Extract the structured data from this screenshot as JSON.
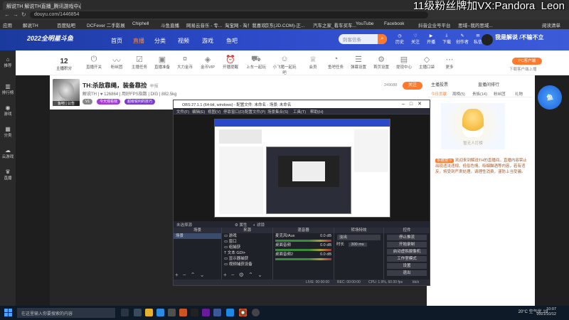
{
  "browser": {
    "tab_title": "解说TH 解说TH直播_腾讯游戏中心",
    "url": "douyu.com/1446854",
    "overlay_text": "11级粉丝牌加VX:Pandora_Leon",
    "bookmarks": [
      "应用",
      "解说TH",
      "百度贴吧",
      "DCFever 二手影展",
      "Chiphell",
      "斗鱼直播",
      "网易云音乐 - 专...",
      "淘宝网 - 淘！我喜欢",
      "京东(JD.COM)-正...",
      "汽车之家_看车买车...",
      "YouTube",
      "Facebook",
      "抖音企业号平台",
      "思域--我的思域..."
    ],
    "reading_list": "阅读清单"
  },
  "site": {
    "logo": "2022全明星斗鱼",
    "nav": [
      {
        "label": "首页"
      },
      {
        "label": "直播"
      },
      {
        "label": "分类"
      },
      {
        "label": "视频"
      },
      {
        "label": "游戏"
      },
      {
        "label": "鱼吧"
      }
    ],
    "search_placeholder": "刺客信条",
    "header_icons": [
      "历史",
      "关注",
      "开播",
      "下载",
      "创作者",
      "领鱼丸",
      "私信"
    ],
    "user_name": "我是解说 /不输不立"
  },
  "leftbar": [
    "推荐",
    "排行榜",
    "游戏",
    "分类",
    "云游戏",
    "直播"
  ],
  "category_bar": {
    "fav_count": "12",
    "fav_label": "主播积分",
    "items": [
      "直播开关",
      "粉丝团",
      "主播任务",
      "直播准备",
      "大力金币",
      "金币VIP",
      "开播提醒",
      "上车一起玩",
      "小飞猪一起玩吧",
      "会员",
      "鱼吧任务",
      "弹幕设置",
      "首页设置",
      "提现中心",
      "主播口袋",
      "更多"
    ],
    "pc_button": "PC客户端",
    "pc_sub": "下载客户端上播"
  },
  "room": {
    "title": "TH:杀敌靠绳，装备靠捡",
    "tag": "举报",
    "meta": "解说TH  |  ♥ 126864  |  用好FPS指数  |  DIG  |  882.5kg",
    "tags": [
      "V1",
      "今天观看我",
      "超级锐利的技巧"
    ],
    "fans": "249088",
    "follow": "关注",
    "avatar_caption": "鱼吧 | 公告"
  },
  "right_panel": {
    "tabs": [
      "主播投票",
      "直播间排行"
    ],
    "subtabs": [
      "今日贡献",
      "周榜(5)",
      "贵族(14)",
      "粉丝团",
      "礼物"
    ],
    "ill_caption": "暂无人打榜",
    "notice_label": "系统提示",
    "notice": "欢迎来到解说TH的直播间。直播内容禁止出现违法违规、低俗色情、吸烟酗酒等内容，若有违反，将受到严肃处理。请理性消费，谨防上当受骗。"
  },
  "obs": {
    "title": "OBS 27.1.1 (64-bit, windows) - 配置文件: 未命名 - 场景: 未命名",
    "menu": [
      "文件(F)",
      "编辑(E)",
      "视图(V)",
      "停靠窗口(D)",
      "配置文件(P)",
      "场景集合(S)",
      "工具(T)",
      "帮助(H)"
    ],
    "source_bar": [
      "未选择源",
      "属性",
      "滤镜"
    ],
    "docks": {
      "scenes": {
        "title": "场景",
        "items": [
          "场景"
        ]
      },
      "sources": {
        "title": "来源",
        "items": [
          "游戏",
          "窗口",
          "组捕获",
          "文本 GDI+",
          "显示器捕获",
          "视频捕获设备"
        ]
      },
      "mixer": {
        "title": "混音器",
        "channels": [
          {
            "name": "麦克风/Aux",
            "db": "0.0 dB"
          },
          {
            "name": "桌面音频",
            "db": "0.0 dB"
          },
          {
            "name": "桌面音频2",
            "db": "0.0 dB"
          }
        ]
      },
      "transitions": {
        "title": "转场特效",
        "type": "淡出",
        "duration_label": "时长",
        "duration": "300 ms"
      },
      "controls": {
        "title": "控件",
        "buttons": [
          "停止推流",
          "开始录制",
          "启动虚拟摄像机",
          "工作室模式",
          "设置",
          "退出"
        ]
      }
    },
    "status": {
      "live": "LIVE: 00:00:00",
      "rec": "REC: 00:00:00",
      "cpu": "CPU: 1.9%, 60.00 fps",
      "kbps": "kb/s"
    }
  },
  "taskbar": {
    "search_placeholder": "在这里输入你要搜索的内容",
    "weather": "20°C 空气优 19",
    "time": "10:07",
    "date": "2021/10/12"
  },
  "colors": {
    "brand": "#2c49c8",
    "accent": "#ff7a2d"
  }
}
